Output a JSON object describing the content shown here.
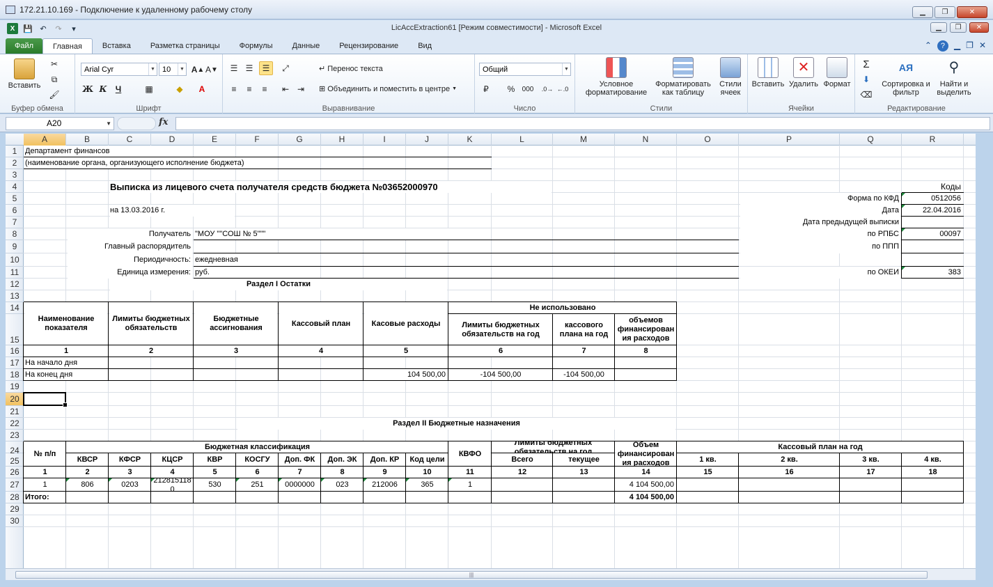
{
  "rdp": {
    "title": "172.21.10.169 - Подключение к удаленному рабочему столу"
  },
  "excel": {
    "title": "LicAccExtraction61  [Режим совместимости]  -  Microsoft Excel"
  },
  "tabs": [
    "Файл",
    "Главная",
    "Вставка",
    "Разметка страницы",
    "Формулы",
    "Данные",
    "Рецензирование",
    "Вид"
  ],
  "ribbon": {
    "clipboard": {
      "label": "Буфер обмена",
      "paste": "Вставить"
    },
    "font": {
      "label": "Шрифт",
      "name": "Arial Cyr",
      "size": "10",
      "bold": "Ж",
      "italic": "К",
      "underline": "Ч"
    },
    "align": {
      "label": "Выравнивание",
      "wrap": "Перенос текста",
      "merge": "Объединить и поместить в центре"
    },
    "number": {
      "label": "Число",
      "format": "Общий",
      "percent": "%",
      "thousands": "000"
    },
    "styles": {
      "label": "Стили",
      "cond": "Условное форматирование",
      "table": "Форматировать как таблицу",
      "cell": "Стили ячеек"
    },
    "cells": {
      "label": "Ячейки",
      "insert": "Вставить",
      "delete": "Удалить",
      "format": "Формат"
    },
    "edit": {
      "label": "Редактирование",
      "sort": "Сортировка и фильтр",
      "find": "Найти и выделить"
    }
  },
  "namebox": "A20",
  "columns": [
    "A",
    "B",
    "C",
    "D",
    "E",
    "F",
    "G",
    "H",
    "I",
    "J",
    "K",
    "L",
    "M",
    "N",
    "O",
    "P",
    "Q",
    "R"
  ],
  "rows": [
    "1",
    "2",
    "3",
    "4",
    "5",
    "6",
    "7",
    "8",
    "9",
    "10",
    "11",
    "12",
    "13",
    "14",
    "15",
    "16",
    "17",
    "18",
    "19",
    "20",
    "21",
    "22",
    "23",
    "24",
    "25",
    "26",
    "27",
    "28",
    "29",
    "30"
  ],
  "sheet": {
    "dept": "Департамент финансов",
    "dept_note": "(наименование органа, организующего исполнение бюджета)",
    "title": "Выписка из лицевого счета получателя средств бюджета №03652000970",
    "date": "на 13.03.2016 г.",
    "recipient_label": "Получатель",
    "recipient": "\"МОУ \"\"СОШ № 5\"\"\"",
    "manager_label": "Главный распорядитель",
    "period_label": "Периодичность:",
    "period": "ежедневная",
    "unit_label": "Единица измерения:",
    "unit": "руб.",
    "codes": "Коды",
    "kfd_label": "Форма по КФД",
    "kfd": "0512056",
    "date_label": "Дата",
    "date_val": "22.04.2016",
    "prev_label": "Дата предыдущей выписки",
    "rpbs_label": "по РПБС",
    "rpbs": "00097",
    "ppp_label": "по ППП",
    "okei_label": "по ОКЕИ",
    "okei": "383",
    "s1": "Раздел I Остатки",
    "t1": {
      "h_name": "Наименование показателя",
      "h_limits": "Лимиты бюджетных обязательств",
      "h_assign": "Бюджетные ассигнования",
      "h_plan": "Кассовый план",
      "h_exp": "Касовые расходы",
      "h_unused": "Не использовано",
      "h_u1": "Лимиты бюджетных обязательств на год",
      "h_u2": "кассового плана на год",
      "h_u3": "объемов финансирован ия расходов",
      "nums": [
        "1",
        "2",
        "3",
        "4",
        "5",
        "6",
        "7",
        "8"
      ],
      "r1": "На начало дня",
      "r2": "На конец дня",
      "r2_exp": "104 500,00",
      "r2_u1": "-104 500,00",
      "r2_u2": "-104 500,00"
    },
    "s2": "Раздел II Бюджетные назначения",
    "t2": {
      "h_no": "№ п/п",
      "h_class": "Бюджетная классификация",
      "h_kvfo": "КВФО",
      "h_lim": "Лимиты бюджетных обязательств на год",
      "h_vol": "Объем финансирован ия расходов",
      "h_kplan": "Кассовый план на год",
      "sub": [
        "КВСР",
        "КФСР",
        "КЦСР",
        "КВР",
        "КОСГУ",
        "Доп. ФК",
        "Доп. ЭК",
        "Доп. КР",
        "Код цели"
      ],
      "h_total": "Всего",
      "h_incl": "В том числе текущее изменение",
      "q": [
        "1 кв.",
        "2 кв.",
        "3 кв.",
        "4 кв."
      ],
      "nums": [
        "1",
        "2",
        "3",
        "4",
        "5",
        "6",
        "7",
        "8",
        "9",
        "10",
        "11",
        "12",
        "13",
        "14",
        "15",
        "16",
        "17",
        "18"
      ],
      "row": [
        "1",
        "806",
        "0203",
        "2128151180",
        "530",
        "251",
        "0000000",
        "023",
        "212006",
        "365",
        "1"
      ],
      "row_vol": "4 104 500,00",
      "itogo": "Итого:",
      "itogo_vol": "4 104 500,00"
    }
  }
}
